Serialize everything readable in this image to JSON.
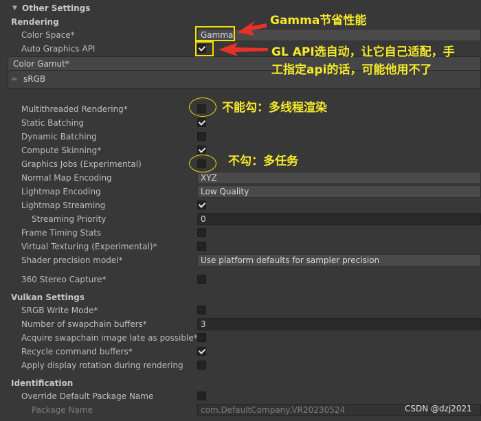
{
  "other_settings": {
    "title": "Other Settings"
  },
  "rendering": {
    "header": "Rendering",
    "color_space": {
      "label": "Color Space*",
      "value": "Gamma"
    },
    "auto_graphics_api": {
      "label": "Auto Graphics API",
      "checked": true
    },
    "color_gamut": {
      "label": "Color Gamut*",
      "item": "sRGB"
    },
    "multithreaded_rendering": {
      "label": "Multithreaded Rendering*",
      "checked": false
    },
    "static_batching": {
      "label": "Static Batching",
      "checked": true
    },
    "dynamic_batching": {
      "label": "Dynamic Batching",
      "checked": false
    },
    "compute_skinning": {
      "label": "Compute Skinning*",
      "checked": true
    },
    "graphics_jobs": {
      "label": "Graphics Jobs (Experimental)",
      "checked": false
    },
    "normal_map_encoding": {
      "label": "Normal Map Encoding",
      "value": "XYZ"
    },
    "lightmap_encoding": {
      "label": "Lightmap Encoding",
      "value": "Low Quality"
    },
    "lightmap_streaming": {
      "label": "Lightmap Streaming",
      "checked": true
    },
    "streaming_priority": {
      "label": "Streaming Priority",
      "value": "0"
    },
    "frame_timing_stats": {
      "label": "Frame Timing Stats",
      "checked": false
    },
    "virtual_texturing": {
      "label": "Virtual Texturing (Experimental)*",
      "checked": false
    },
    "shader_precision": {
      "label": "Shader precision model*",
      "value": "Use platform defaults for sampler precision"
    },
    "stereo_capture": {
      "label": "360 Stereo Capture*",
      "checked": false
    }
  },
  "vulkan": {
    "header": "Vulkan Settings",
    "srgb_write_mode": {
      "label": "SRGB Write Mode*",
      "checked": false
    },
    "swapchain_buffers": {
      "label": "Number of swapchain buffers*",
      "value": "3"
    },
    "acquire_late": {
      "label": "Acquire swapchain image late as possible*",
      "checked": false
    },
    "recycle_buffers": {
      "label": "Recycle command buffers*",
      "checked": true
    },
    "display_rotation": {
      "label": "Apply display rotation during rendering",
      "checked": false
    }
  },
  "identification": {
    "header": "Identification",
    "override_package": {
      "label": "Override Default Package Name",
      "checked": false
    },
    "package_name": {
      "label": "Package Name",
      "value": "com.DefaultCompany.VR20230524"
    }
  },
  "annotations": {
    "gamma": "Gamma节省性能",
    "gl_api_line1": "GL API选自动，让它自己适配，手",
    "gl_api_line2": "工指定api的话，可能他用不了",
    "multithread": "不能勾：多线程渲染",
    "graphics_jobs": "不勾：多任务",
    "color": "#f5e000",
    "arrow_color": "#e8312a"
  },
  "watermark": "CSDN @dzj2021"
}
